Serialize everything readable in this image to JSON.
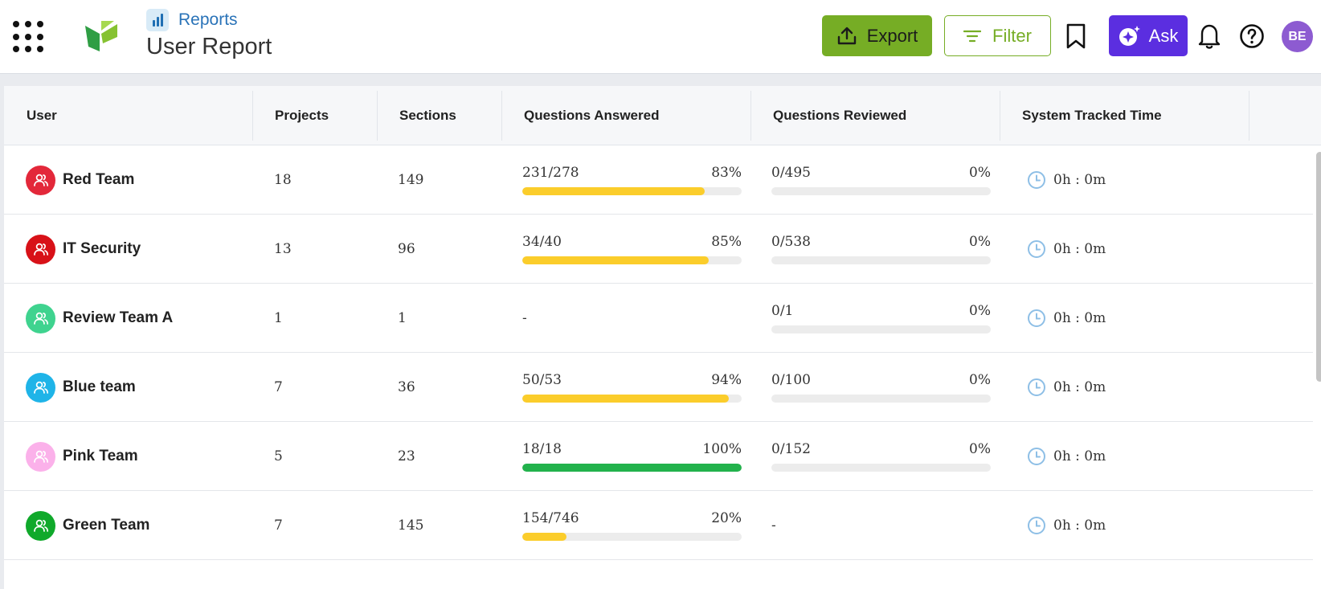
{
  "header": {
    "breadcrumb": "Reports",
    "title": "User Report",
    "export_label": "Export",
    "filter_label": "Filter",
    "ask_label": "Ask",
    "avatar_initials": "BE"
  },
  "colors": {
    "accent_green": "#76ad25",
    "ask_purple": "#5b2ee0",
    "progress_yellow": "#fbcd2b",
    "progress_green": "#22b24c",
    "avatar_purple": "#8d5bd1"
  },
  "table": {
    "columns": [
      "User",
      "Projects",
      "Sections",
      "Questions Answered",
      "Questions Reviewed",
      "System Tracked Time"
    ],
    "rows": [
      {
        "user": "Red Team",
        "avatar_color": "#e3283a",
        "projects": "18",
        "sections": "149",
        "answered": {
          "text": "231/278",
          "pct": "83%",
          "value": 0.83,
          "color": "#fbcd2b"
        },
        "reviewed": {
          "text": "0/495",
          "pct": "0%",
          "value": 0
        },
        "time": "0h : 0m"
      },
      {
        "user": "IT Security",
        "avatar_color": "#d81118",
        "projects": "13",
        "sections": "96",
        "answered": {
          "text": "34/40",
          "pct": "85%",
          "value": 0.85,
          "color": "#fbcd2b"
        },
        "reviewed": {
          "text": "0/538",
          "pct": "0%",
          "value": 0
        },
        "time": "0h : 0m"
      },
      {
        "user": "Review Team A",
        "avatar_color": "#3fd38f",
        "projects": "1",
        "sections": "1",
        "answered": null,
        "answered_empty": "-",
        "reviewed": {
          "text": "0/1",
          "pct": "0%",
          "value": 0
        },
        "time": "0h : 0m"
      },
      {
        "user": "Blue team",
        "avatar_color": "#1fb4e8",
        "projects": "7",
        "sections": "36",
        "answered": {
          "text": "50/53",
          "pct": "94%",
          "value": 0.94,
          "color": "#fbcd2b"
        },
        "reviewed": {
          "text": "0/100",
          "pct": "0%",
          "value": 0
        },
        "time": "0h : 0m"
      },
      {
        "user": "Pink Team",
        "avatar_color": "#fbb1ea",
        "projects": "5",
        "sections": "23",
        "answered": {
          "text": "18/18",
          "pct": "100%",
          "value": 1.0,
          "color": "#22b24c"
        },
        "reviewed": {
          "text": "0/152",
          "pct": "0%",
          "value": 0
        },
        "time": "0h : 0m"
      },
      {
        "user": "Green Team",
        "avatar_color": "#10a92b",
        "projects": "7",
        "sections": "145",
        "answered": {
          "text": "154/746",
          "pct": "20%",
          "value": 0.2,
          "color": "#fbcd2b"
        },
        "reviewed": null,
        "reviewed_empty": "-",
        "time": "0h : 0m"
      }
    ]
  }
}
